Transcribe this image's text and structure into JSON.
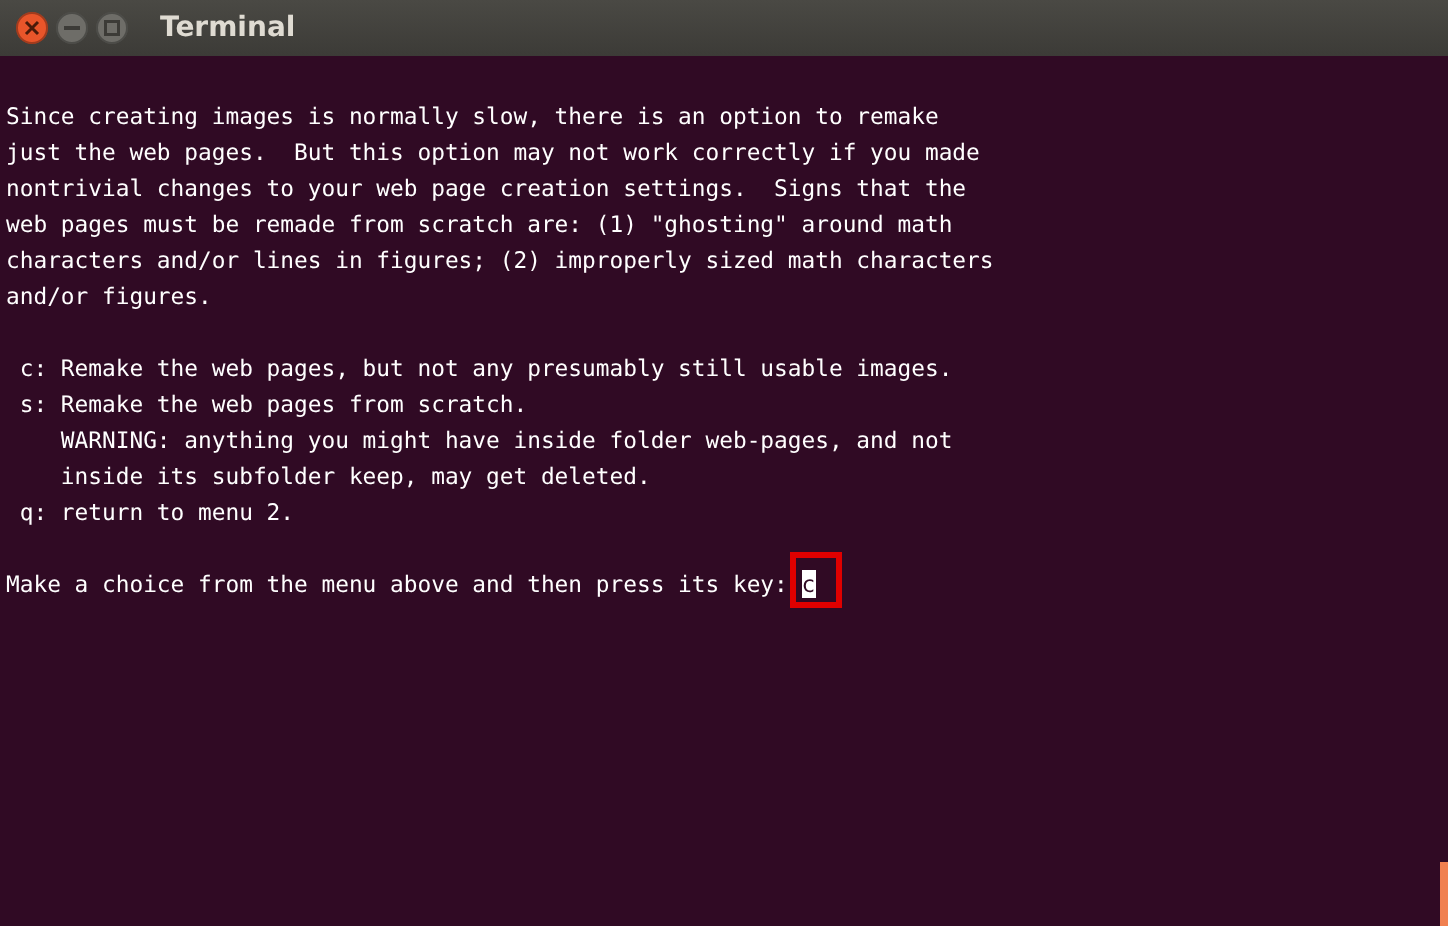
{
  "window": {
    "title": "Terminal"
  },
  "terminal": {
    "paragraphs": [
      [
        "Since creating images is normally slow, there is an option to remake",
        "just the web pages.  But this option may not work correctly if you made",
        "nontrivial changes to your web page creation settings.  Signs that the",
        "web pages must be remade from scratch are: (1) \"ghosting\" around math",
        "characters and/or lines in figures; (2) improperly sized math characters",
        "and/or figures."
      ],
      [
        " c: Remake the web pages, but not any presumably still usable images.",
        " s: Remake the web pages from scratch.",
        "    WARNING: anything you might have inside folder web-pages, and not",
        "    inside its subfolder keep, may get deleted.",
        " q: return to menu 2."
      ]
    ],
    "prompt": "Make a choice from the menu above and then press its key: ",
    "input": "c"
  }
}
